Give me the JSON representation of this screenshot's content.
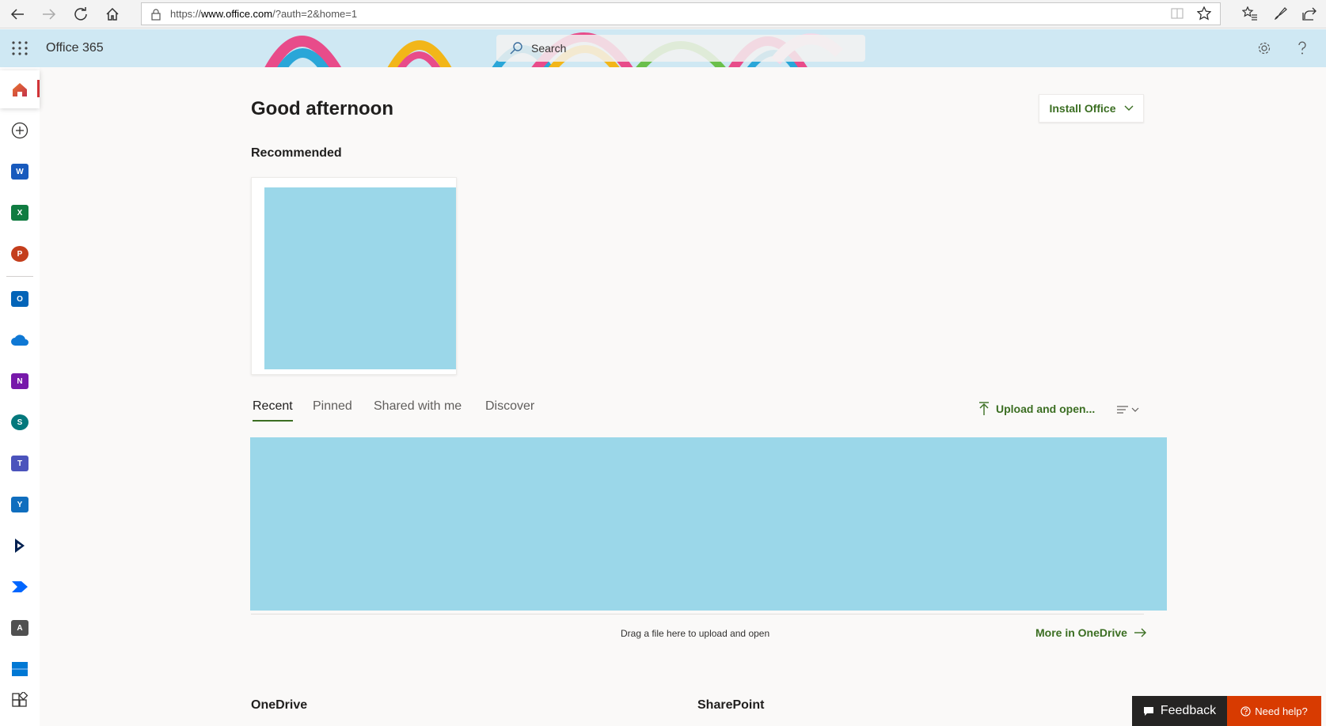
{
  "browser": {
    "url_prefix": "https://",
    "url_host": "www.office.com",
    "url_path": "/?auth=2&home=1"
  },
  "header": {
    "app_title": "Office 365",
    "search_placeholder": "Search"
  },
  "rail": {
    "apps": [
      {
        "icon": "home-icon",
        "active": true
      },
      {
        "icon": "create-icon"
      },
      {
        "icon": "word-icon",
        "letter": "W",
        "color": "#185abd"
      },
      {
        "icon": "excel-icon",
        "letter": "X",
        "color": "#107c41"
      },
      {
        "icon": "powerpoint-icon",
        "letter": "P",
        "color": "#c43e1c"
      },
      {
        "icon": "outlook-icon",
        "letter": "O",
        "color": "#0364b8"
      },
      {
        "icon": "onedrive-icon",
        "color": "#0364b8"
      },
      {
        "icon": "onenote-icon",
        "letter": "N",
        "color": "#7719aa"
      },
      {
        "icon": "sharepoint-icon",
        "letter": "S",
        "color": "#03787c"
      },
      {
        "icon": "teams-icon",
        "letter": "T",
        "color": "#4b53bc"
      },
      {
        "icon": "yammer-icon",
        "letter": "Y",
        "color": "#106ebe"
      },
      {
        "icon": "dynamics-icon",
        "color": "#002050"
      },
      {
        "icon": "power-automate-icon",
        "color": "#0066ff"
      },
      {
        "icon": "admin-icon",
        "letter": "A",
        "color": "#505050"
      },
      {
        "icon": "store-icon",
        "color": "#0078d4"
      },
      {
        "icon": "all-apps-icon"
      }
    ]
  },
  "main": {
    "greeting": "Good afternoon",
    "install_label": "Install Office",
    "recommended_title": "Recommended",
    "tabs": [
      {
        "label": "Recent",
        "active": true
      },
      {
        "label": "Pinned"
      },
      {
        "label": "Shared with me"
      },
      {
        "label": "Discover"
      }
    ],
    "upload_label": "Upload and open...",
    "drag_hint": "Drag a file here to upload and open",
    "more_link": "More in OneDrive",
    "onedrive_title": "OneDrive",
    "sharepoint_title": "SharePoint"
  },
  "footer": {
    "feedback_label": "Feedback",
    "help_label": "Need help?"
  },
  "colors": {
    "accent_green": "#3b6e22",
    "header_bg": "#cfe8f3",
    "placeholder_blue": "#9bd7e9",
    "help_orange": "#d83b01"
  }
}
